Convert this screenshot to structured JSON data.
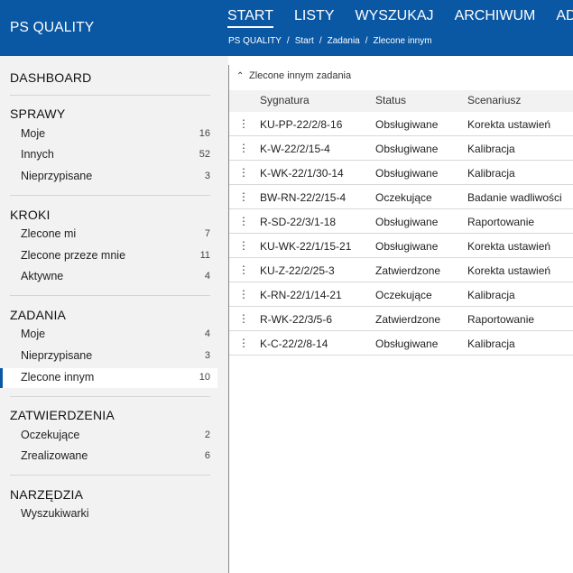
{
  "app": {
    "title": "PS QUALITY"
  },
  "nav": [
    {
      "label": "START",
      "active": true
    },
    {
      "label": "LISTY"
    },
    {
      "label": "WYSZUKAJ"
    },
    {
      "label": "ARCHIWUM"
    },
    {
      "label": "ADMIN"
    }
  ],
  "breadcrumb": [
    "PS QUALITY",
    "Start",
    "Zadania",
    "Zlecone innym"
  ],
  "breadcrumb_sep": "/",
  "sidebar": {
    "dashboard": "DASHBOARD",
    "sprawy": {
      "heading": "SPRAWY",
      "items": [
        {
          "label": "Moje",
          "count": "16"
        },
        {
          "label": "Innych",
          "count": "52"
        },
        {
          "label": "Nieprzypisane",
          "count": "3"
        }
      ]
    },
    "kroki": {
      "heading": "KROKI",
      "items": [
        {
          "label": "Zlecone mi",
          "count": "7"
        },
        {
          "label": "Zlecone przeze mnie",
          "count": "11"
        },
        {
          "label": "Aktywne",
          "count": "4"
        }
      ]
    },
    "zadania": {
      "heading": "ZADANIA",
      "items": [
        {
          "label": "Moje",
          "count": "4"
        },
        {
          "label": "Nieprzypisane",
          "count": "3"
        },
        {
          "label": "Zlecone innym",
          "count": "10",
          "active": true
        }
      ]
    },
    "zatwierdzenia": {
      "heading": "ZATWIERDZENIA",
      "items": [
        {
          "label": "Oczekujące",
          "count": "2"
        },
        {
          "label": "Zrealizowane",
          "count": "6"
        }
      ]
    },
    "narzedzia": {
      "heading": "NARZĘDZIA",
      "items": [
        {
          "label": "Wyszukiwarki"
        }
      ]
    }
  },
  "panel": {
    "title": "Zlecone innym zadania",
    "columns": [
      "Sygnatura",
      "Status",
      "Scenariusz"
    ],
    "rows": [
      [
        "KU-PP-22/2/8-16",
        "Obsługiwane",
        "Korekta ustawień"
      ],
      [
        "K-W-22/2/15-4",
        "Obsługiwane",
        "Kalibracja"
      ],
      [
        "K-WK-22/1/30-14",
        "Obsługiwane",
        "Kalibracja"
      ],
      [
        "BW-RN-22/2/15-4",
        "Oczekujące",
        "Badanie wadliwości"
      ],
      [
        "R-SD-22/3/1-18",
        "Obsługiwane",
        "Raportowanie"
      ],
      [
        "KU-WK-22/1/15-21",
        "Obsługiwane",
        "Korekta ustawień"
      ],
      [
        "KU-Z-22/2/25-3",
        "Zatwierdzone",
        "Korekta ustawień"
      ],
      [
        "K-RN-22/1/14-21",
        "Oczekujące",
        "Kalibracja"
      ],
      [
        "R-WK-22/3/5-6",
        "Zatwierdzone",
        "Raportowanie"
      ],
      [
        "K-C-22/2/8-14",
        "Obsługiwane",
        "Kalibracja"
      ]
    ]
  },
  "colors": {
    "brand": "#0a57a4",
    "sidebar_bg": "#f2f2f2"
  }
}
